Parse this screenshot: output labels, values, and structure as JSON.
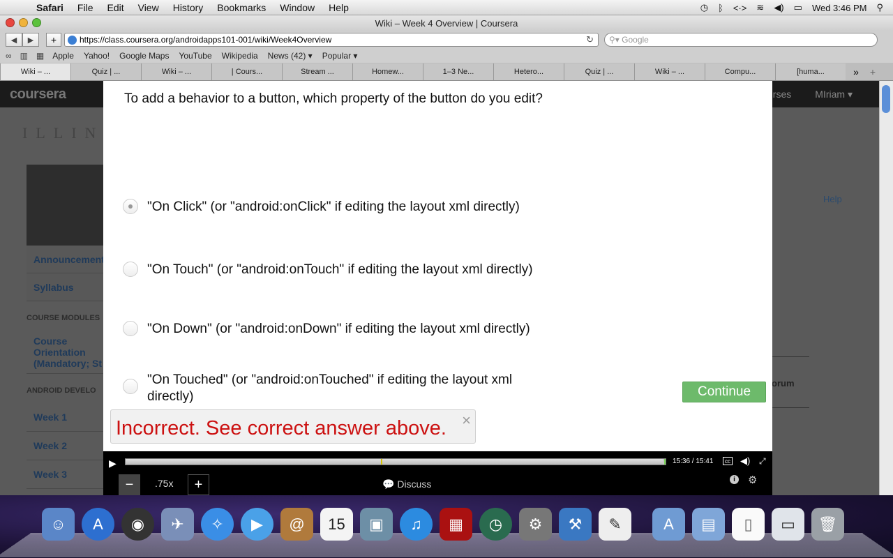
{
  "menubar": {
    "app": "Safari",
    "items": [
      "File",
      "Edit",
      "View",
      "History",
      "Bookmarks",
      "Window",
      "Help"
    ],
    "clock": "Wed 3:46 PM"
  },
  "window": {
    "title": "Wiki – Week 4 Overview | Coursera",
    "url": "https://class.coursera.org/androidapps101-001/wiki/Week4Overview",
    "search_placeholder": "Google"
  },
  "bookmarks": [
    "Apple",
    "Yahoo!",
    "Google Maps",
    "YouTube",
    "Wikipedia",
    "News (42) ▾",
    "Popular ▾"
  ],
  "tabs": [
    "Wiki – ...",
    "Quiz | ...",
    "Wiki – ...",
    "| Cours...",
    "Stream ...",
    "Homew...",
    "1–3 Ne...",
    "Hetero...",
    "Quiz | ...",
    "Wiki – ...",
    "Compu...",
    "[huma..."
  ],
  "page": {
    "logo": "coursera",
    "user": "MIriam ▾",
    "courses": "urses",
    "illinois": "ILLIN",
    "help": "Help",
    "forum": "orum",
    "sidebar": {
      "items": [
        "Announcements",
        "Syllabus"
      ],
      "section1": "COURSE MODULES",
      "course_item": "Course Orientation (Mandatory; St",
      "section2": "ANDROID DEVELO",
      "weeks": [
        "Week 1",
        "Week 2",
        "Week 3"
      ]
    }
  },
  "quiz": {
    "question": "To add a behavior to a button, which property of the button do you edit?",
    "options": [
      "\"On Click\" (or \"android:onClick\" if editing the layout xml directly)",
      "\"On Touch\" (or \"android:onTouch\" if editing the layout xml directly)",
      "\"On Down\" (or \"android:onDown\" if editing the layout xml directly)",
      "\"On Touched\" (or \"android:onTouched\" if editing the layout xml directly)"
    ],
    "continue_label": "Continue",
    "feedback": "Incorrect. See correct answer above.",
    "close_label": "×"
  },
  "player": {
    "time": "15:36 / 15:41",
    "progress": 0.995,
    "speed": ".75x",
    "discuss": "Discuss",
    "cc": "cc"
  },
  "colors": {
    "continue": "#6dba6b",
    "error": "#cc1111",
    "coursera_header": "#1b1b1b"
  }
}
